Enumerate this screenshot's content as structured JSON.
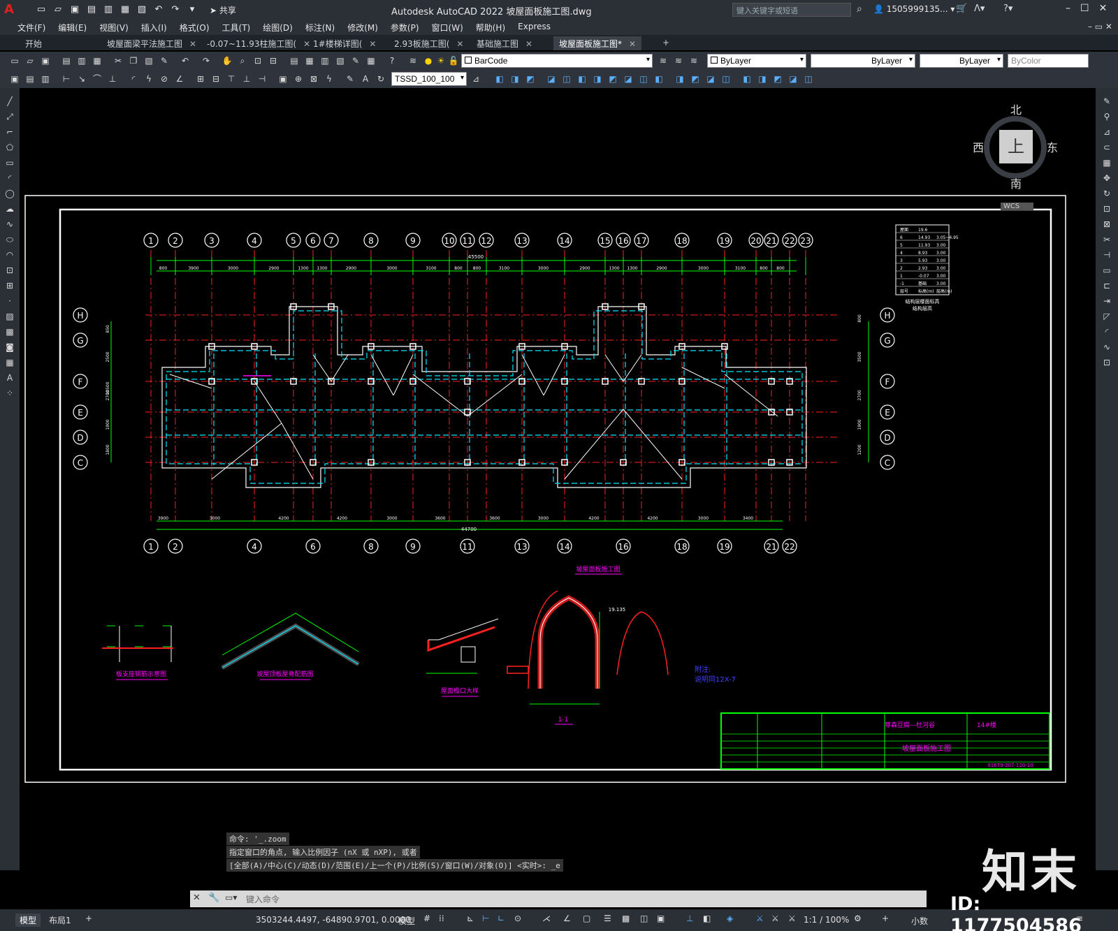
{
  "app": {
    "title": "Autodesk AutoCAD 2022    坡屋面板施工图.dwg",
    "share_label": "共享",
    "search_placeholder": "键入关键字或短语",
    "user": "1505999135...",
    "logo": "A"
  },
  "menu": [
    "文件(F)",
    "编辑(E)",
    "视图(V)",
    "插入(I)",
    "格式(O)",
    "工具(T)",
    "绘图(D)",
    "标注(N)",
    "修改(M)",
    "参数(P)",
    "窗口(W)",
    "帮助(H)",
    "Express"
  ],
  "tabs": [
    {
      "label": "开始",
      "close": ""
    },
    {
      "label": "坡屋面梁平法施工图",
      "close": "✕"
    },
    {
      "label": "-0.07~11.93柱施工图(",
      "close": "✕"
    },
    {
      "label": "1#楼梯详图(",
      "close": "✕"
    },
    {
      "label": "2.93板施工图(",
      "close": "✕"
    },
    {
      "label": "基础施工图",
      "close": "✕"
    },
    {
      "label": "坡屋面板施工图*",
      "close": "✕"
    }
  ],
  "tab_add": "+",
  "toolbar": {
    "layer": "BarCode",
    "color": "ByLayer",
    "linetype": "ByLayer",
    "lineweight": "ByLayer",
    "plotstyle": "ByColor",
    "dimstyle": "TSSD_100_100"
  },
  "viewcube": {
    "north": "北",
    "south": "南",
    "east": "东",
    "west": "西",
    "top": "上",
    "wcs": "WCS"
  },
  "drawing": {
    "axes_top": [
      "1",
      "2",
      "3",
      "4",
      "5",
      "6",
      "7",
      "8",
      "9",
      "10",
      "11",
      "12",
      "13",
      "14",
      "15",
      "16",
      "17",
      "18",
      "19",
      "20",
      "21",
      "22",
      "23"
    ],
    "axes_bottom": [
      "1",
      "2",
      "4",
      "6",
      "8",
      "9",
      "11",
      "13",
      "14",
      "16",
      "18",
      "19",
      "21",
      "22"
    ],
    "axes_rows": [
      "H",
      "G",
      "F",
      "E",
      "D",
      "C"
    ],
    "top_total": "45500",
    "bottom_total": "44700",
    "top_dims": [
      "800",
      "3900",
      "3000",
      "2900",
      "1300",
      "1300",
      "2900",
      "3000",
      "3100",
      "800",
      "800",
      "3100",
      "3000",
      "2900",
      "1300",
      "1300",
      "2900",
      "3000",
      "3100",
      "800",
      "800"
    ],
    "bottom_dims": [
      "3900",
      "3000",
      "4200",
      "4200",
      "3000",
      "3600",
      "3600",
      "3000",
      "4200",
      "4200",
      "3000",
      "3400"
    ],
    "left_dims": [
      "850",
      "2500",
      "2700",
      "1900",
      "1800",
      "10500"
    ],
    "right_dims": [
      "800",
      "3500",
      "2700",
      "1900",
      "1200"
    ],
    "table_rows": [
      [
        "屋面",
        "19.6",
        ""
      ],
      [
        "6",
        "14.93",
        "3.05~4.95"
      ],
      [
        "5",
        "11.93",
        "3.00"
      ],
      [
        "4",
        "8.93",
        "3.00"
      ],
      [
        "3",
        "5.93",
        "3.00"
      ],
      [
        "2",
        "2.93",
        "3.00"
      ],
      [
        "1",
        "-0.07",
        "3.00"
      ],
      [
        "-1",
        "基础",
        "3.00"
      ],
      [
        "层号",
        "标高(m)",
        "层高(m)"
      ]
    ],
    "table_caption": "结构层楼面标高\n结构层高",
    "detail_titles": [
      "板支座钢筋示意图",
      "坡屋顶板屋脊配筋图",
      "屋面檐口大样",
      "1-1"
    ],
    "note_title": "坡屋面板施工图",
    "note_right": "附注:\n说明同12X-7",
    "elev_label": "19.135"
  },
  "title_block": {
    "project": "尊森豆腐—杜河谷",
    "building": "14#楼",
    "drawing_name": "坡屋面板施工图",
    "sheet_code": "91679-307-120-10"
  },
  "command": {
    "history1": "命令: '_.zoom",
    "history2": "指定窗口的角点, 输入比例因子 (nX 或 nXP), 或者",
    "history3": "[全部(A)/中心(C)/动态(D)/范围(E)/上一个(P)/比例(S)/窗口(W)/对象(O)] <实时>: _e",
    "placeholder": "键入命令"
  },
  "status": {
    "model_tab": "模型",
    "layout_tab": "布局1",
    "add_layout": "+",
    "coords": "3503244.4497, -64890.9701, 0.0000",
    "space": "模型",
    "scale": "1:1 / 100%",
    "units": "小数"
  },
  "watermark": {
    "brand": "知末",
    "id": "ID: 1177504586"
  },
  "colors": {
    "grid_red": "#ff2020",
    "cyan": "#00e5ff",
    "green": "#00ff00",
    "white": "#ffffff",
    "magenta": "#ff00ff"
  }
}
